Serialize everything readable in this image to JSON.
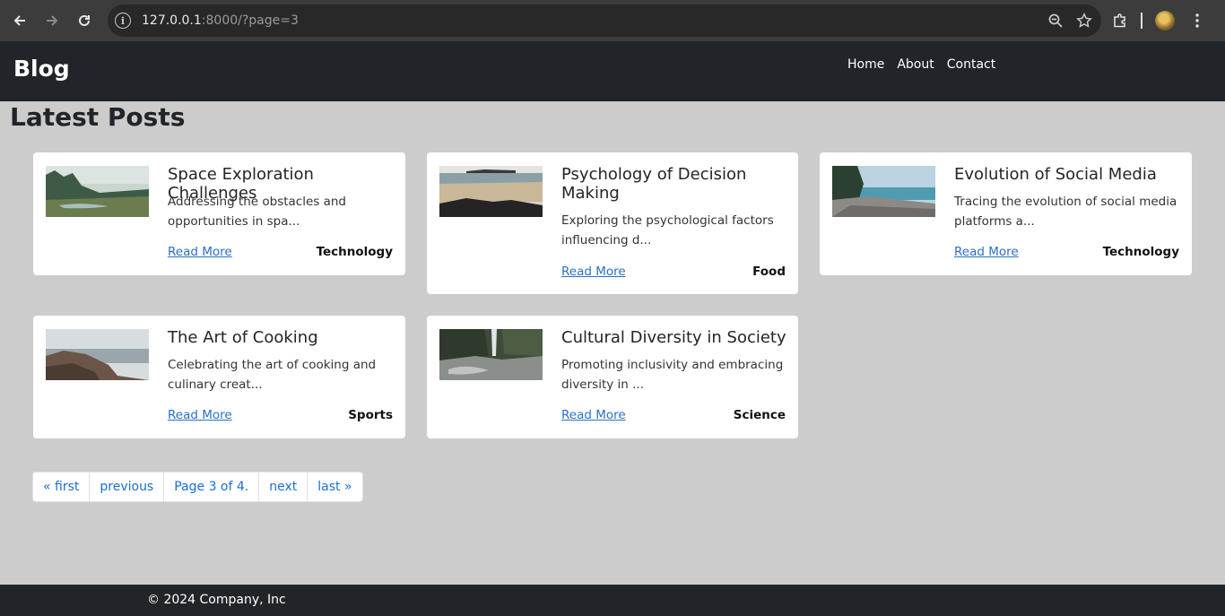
{
  "browser": {
    "url_host": "127.0.0.1",
    "url_rest": ":8000/?page=3"
  },
  "header": {
    "brand": "Blog",
    "nav": [
      "Home",
      "About",
      "Contact"
    ]
  },
  "main": {
    "title": "Latest Posts",
    "posts": [
      {
        "title": "Space Exploration Challenges",
        "excerpt": "Addressing the obstacles and opportunities in spa...",
        "link": "Read More",
        "category": "Technology"
      },
      {
        "title": "Psychology of Decision Making",
        "excerpt": "Exploring the psychological factors influencing d...",
        "link": "Read More",
        "category": "Food"
      },
      {
        "title": "Evolution of Social Media",
        "excerpt": "Tracing the evolution of social media platforms a...",
        "link": "Read More",
        "category": "Technology"
      },
      {
        "title": "The Art of Cooking",
        "excerpt": "Celebrating the art of cooking and culinary creat...",
        "link": "Read More",
        "category": "Sports"
      },
      {
        "title": "Cultural Diversity in Society",
        "excerpt": "Promoting inclusivity and embracing diversity in ...",
        "link": "Read More",
        "category": "Science"
      }
    ]
  },
  "pagination": {
    "first": "« first",
    "previous": "previous",
    "current": "Page 3 of 4.",
    "next": "next",
    "last": "last »"
  },
  "footer": {
    "text": "© 2024 Company, Inc"
  },
  "colors": {
    "page_bg": "#cccccc",
    "header_bg": "#212529",
    "link": "#2a6fc9"
  }
}
